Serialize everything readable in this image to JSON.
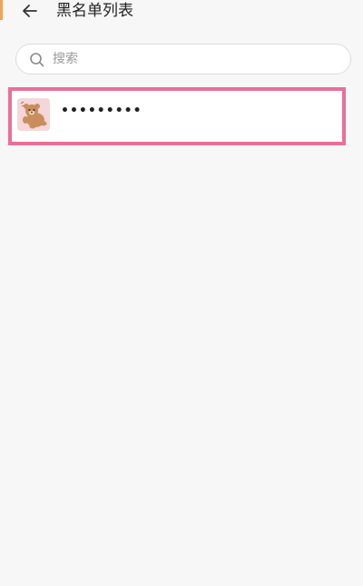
{
  "header": {
    "back_icon": "back-arrow-icon",
    "title": "黑名单列表"
  },
  "search": {
    "icon": "search-icon",
    "placeholder": "搜索",
    "value": ""
  },
  "blacklist": {
    "items": [
      {
        "avatar_icon": "cartoon-bear-avatar",
        "name": "•••••••••"
      }
    ]
  },
  "colors": {
    "background": "#f7f7f7",
    "highlight_border": "#ea6f97",
    "avatar_background": "#f6d7d9"
  }
}
